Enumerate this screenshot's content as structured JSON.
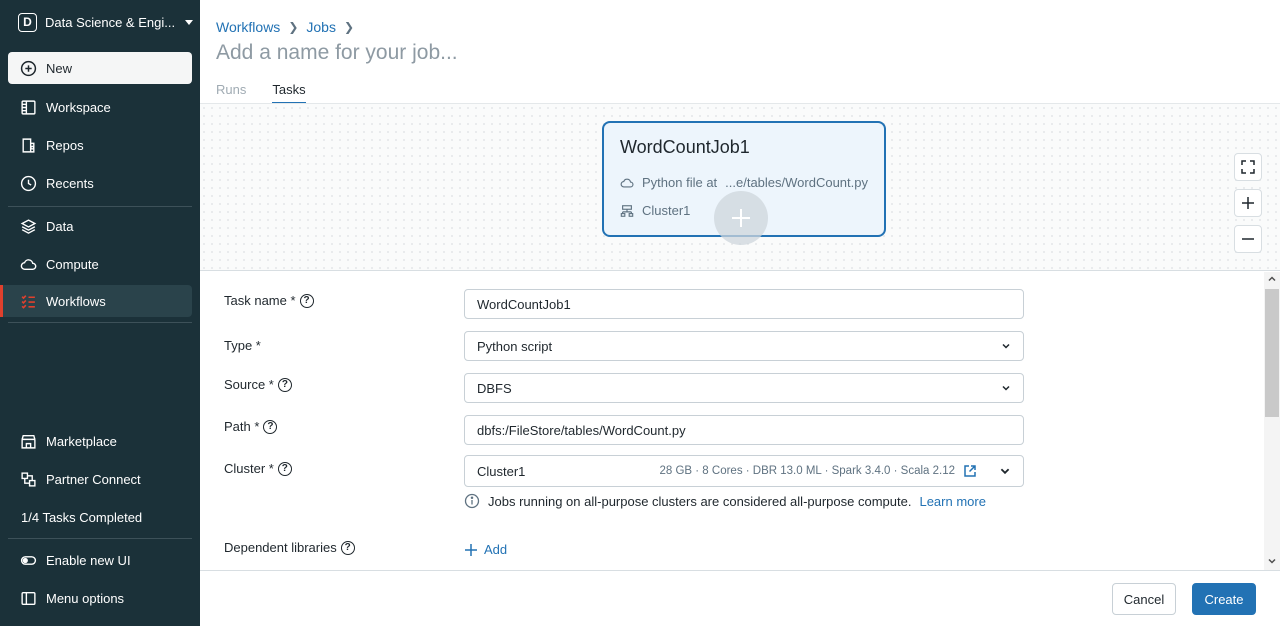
{
  "sidebar": {
    "workspace": {
      "badge": "D",
      "name": "Data Science & Engi..."
    },
    "items": [
      {
        "label": "New",
        "icon": "plus-circle-icon"
      },
      {
        "label": "Workspace",
        "icon": "workspace-icon"
      },
      {
        "label": "Repos",
        "icon": "repos-icon"
      },
      {
        "label": "Recents",
        "icon": "clock-icon"
      },
      {
        "label": "Data",
        "icon": "data-icon"
      },
      {
        "label": "Compute",
        "icon": "cloud-icon"
      },
      {
        "label": "Workflows",
        "icon": "workflows-icon"
      }
    ],
    "bottom_items": [
      {
        "label": "Marketplace",
        "icon": "store-icon"
      },
      {
        "label": "Partner Connect",
        "icon": "partner-connect-icon"
      },
      {
        "label": "1/4 Tasks Completed"
      },
      {
        "label": "Enable new UI",
        "icon": "toggle-icon"
      },
      {
        "label": "Menu options",
        "icon": "sidebar-icon"
      }
    ]
  },
  "header": {
    "breadcrumb": [
      "Workflows",
      "Jobs"
    ],
    "title_placeholder": "Add a name for your job...",
    "tabs": [
      {
        "label": "Runs",
        "active": false
      },
      {
        "label": "Tasks",
        "active": true
      }
    ]
  },
  "canvas": {
    "node": {
      "title": "WordCountJob1",
      "file_prefix": "Python file at",
      "file_path": "...e/tables/WordCount.py",
      "cluster": "Cluster1"
    }
  },
  "form": {
    "task_name": {
      "label": "Task name *",
      "value": "WordCountJob1"
    },
    "type": {
      "label": "Type *",
      "value": "Python script"
    },
    "source": {
      "label": "Source *",
      "value": "DBFS"
    },
    "path": {
      "label": "Path *",
      "value": "dbfs:/FileStore/tables/WordCount.py"
    },
    "cluster": {
      "label": "Cluster *",
      "value": "Cluster1",
      "meta": "28 GB · 8 Cores · DBR 13.0 ML · Spark 3.4.0 · Scala 2.12"
    },
    "cluster_info": "Jobs running on all-purpose clusters are considered all-purpose compute.",
    "learn_more": "Learn more",
    "dependent_libraries": {
      "label": "Dependent libraries",
      "add_label": "Add"
    }
  },
  "footer": {
    "cancel": "Cancel",
    "create": "Create"
  },
  "colors": {
    "sidebar_bg": "#1b3139",
    "accent": "#2272b4",
    "active_marker": "#e0402d"
  }
}
